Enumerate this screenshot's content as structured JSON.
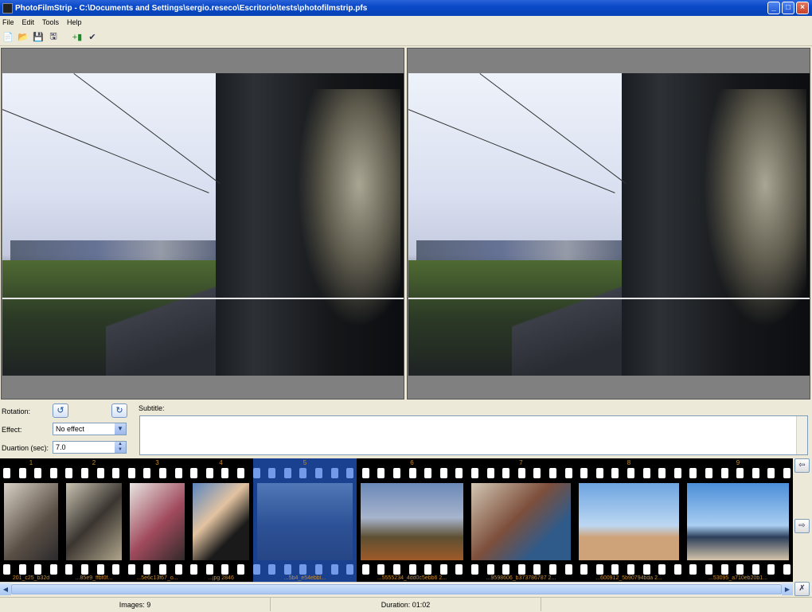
{
  "window": {
    "title": "PhotoFilmStrip - C:\\Documents and Settings\\sergio.reseco\\Escritorio\\tests\\photofilmstrip.pfs"
  },
  "menu": [
    "File",
    "Edit",
    "Tools",
    "Help"
  ],
  "toolbar_icons": [
    "new-project-icon",
    "open-project-icon",
    "save-icon",
    "save-as-icon",
    "import-pictures-icon",
    "render-check-icon"
  ],
  "properties": {
    "rotation_label": "Rotation:",
    "effect_label": "Effect:",
    "effect_value": "No effect",
    "duration_label": "Duartion (sec):",
    "duration_value": "7.0",
    "subtitle_label": "Subtitle:"
  },
  "filmstrip": {
    "selected_index": 5,
    "frames": [
      {
        "num": "1",
        "name": "201_c25_b32d"
      },
      {
        "num": "2",
        "name": "...85e9_ffbf0f..."
      },
      {
        "num": "3",
        "name": "...5e6c13f67_o..."
      },
      {
        "num": "4",
        "name": "...jpg 2846"
      },
      {
        "num": "5",
        "name": "...5b4_e54ebbl..."
      },
      {
        "num": "6",
        "name": "...5555234_4dd0c5ebb6 2..."
      },
      {
        "num": "7",
        "name": "...9598606_b373786787 2..."
      },
      {
        "num": "8",
        "name": "...600912_5b90794bda 2..."
      },
      {
        "num": "9",
        "name": "...53095_a710eb20b1..."
      }
    ]
  },
  "status": {
    "images": "Images: 9",
    "duration": "Duration: 01:02"
  }
}
